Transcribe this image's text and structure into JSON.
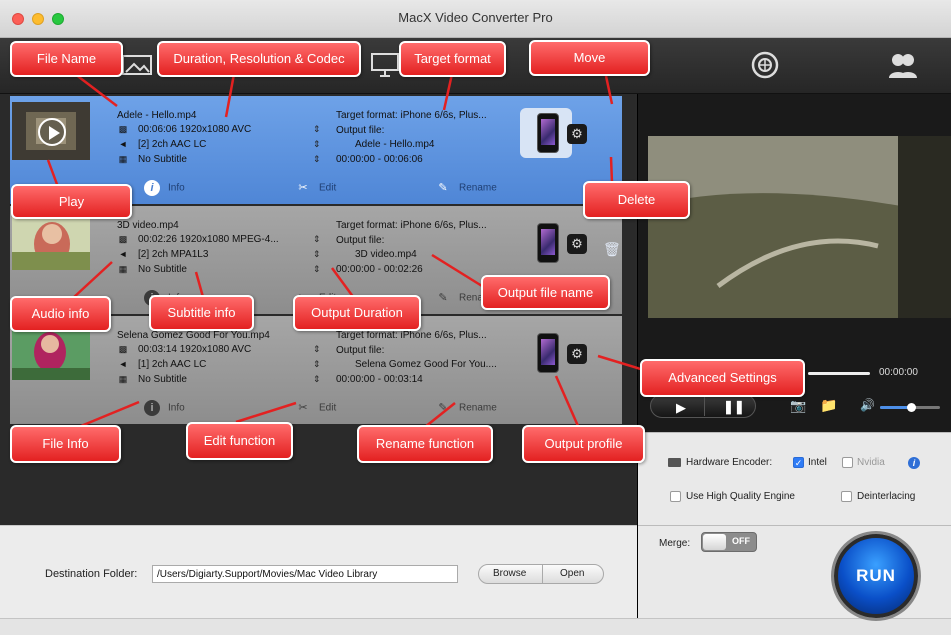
{
  "window": {
    "title": "MacX Video Converter Pro"
  },
  "toolbar": {
    "icons": [
      "add-video-icon",
      "photo-icon",
      "youtube-icon",
      "dvd-icon",
      "screen-recorder-icon",
      "video-edit-icon",
      "update-icon",
      "user-account-icon"
    ]
  },
  "items": [
    {
      "name": "Adele - Hello.mp4",
      "meta": "00:06:06 1920x1080 AVC",
      "audio": "[2] 2ch AAC LC",
      "subtitle": "No Subtitle",
      "target": "Target format: iPhone 6/6s, Plus...",
      "output_label": "Output file:",
      "output_file": "Adele - Hello.mp4",
      "duration": "00:00:00 - 00:06:06",
      "selected": true
    },
    {
      "name": "3D video.mp4",
      "meta": "00:02:26 1920x1080 MPEG-4...",
      "audio": "[2] 2ch MPA1L3",
      "subtitle": "No Subtitle",
      "target": "Target format: iPhone 6/6s, Plus...",
      "output_label": "Output file:",
      "output_file": "3D video.mp4",
      "duration": "00:00:00 - 00:02:26",
      "selected": false
    },
    {
      "name": "Selena Gomez Good For You.mp4",
      "meta": "00:03:14 1920x1080 AVC",
      "audio": "[1] 2ch AAC LC",
      "subtitle": "No Subtitle",
      "target": "Target format: iPhone 6/6s, Plus...",
      "output_label": "Output file:",
      "output_file": "Selena Gomez Good For You....",
      "duration": "00:00:00 - 00:03:14",
      "selected": false
    }
  ],
  "actions": {
    "info": "Info",
    "edit": "Edit",
    "rename": "Rename"
  },
  "destination": {
    "label": "Destination Folder:",
    "path": "/Users/Digiarty.Support/Movies/Mac Video Library",
    "browse": "Browse",
    "open": "Open"
  },
  "player": {
    "time": "00:00:00"
  },
  "settings": {
    "hw_label": "Hardware Encoder:",
    "intel": "Intel",
    "intel_checked": true,
    "nvidia": "Nvidia",
    "nvidia_checked": false,
    "hq": "Use High Quality Engine",
    "deint": "Deinterlacing"
  },
  "merge": {
    "label": "Merge:",
    "state": "OFF"
  },
  "run_label": "RUN",
  "callouts": {
    "file_name": "File Name",
    "duration_res": "Duration, Resolution & Codec",
    "target_format": "Target format",
    "move": "Move",
    "play": "Play",
    "delete": "Delete",
    "audio_info": "Audio info",
    "subtitle_info": "Subtitle info",
    "output_duration": "Output Duration",
    "output_file_name": "Output file name",
    "advanced_settings": "Advanced Settings",
    "file_info": "File Info",
    "edit_function": "Edit function",
    "rename_function": "Rename function",
    "output_profile": "Output profile"
  },
  "colors": {
    "accent": "#4f86d6",
    "callout": "#e32121",
    "run": "#0a4fc8"
  }
}
